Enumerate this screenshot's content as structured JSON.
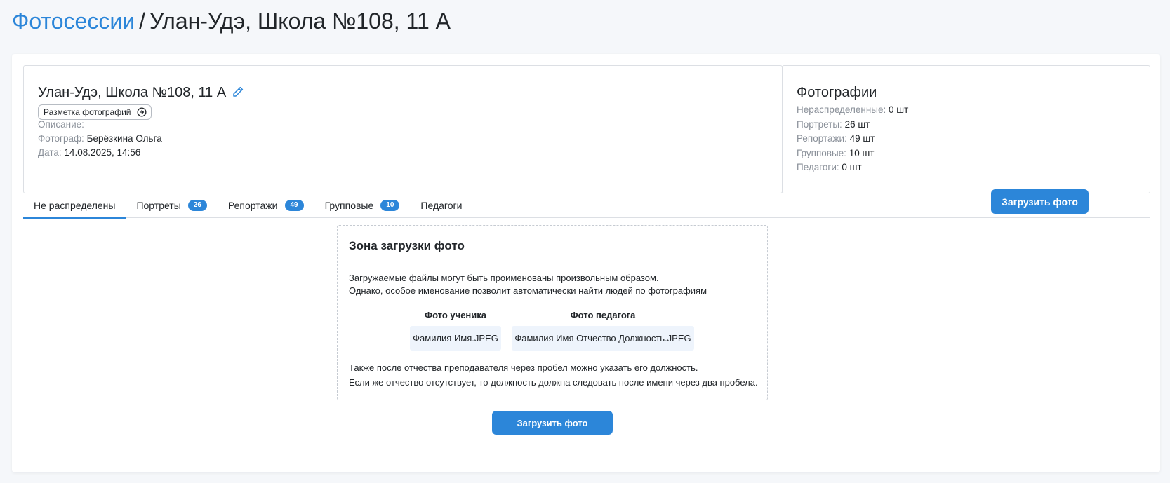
{
  "breadcrumb": {
    "root": "Фотосессии",
    "separator": "/",
    "current": "Улан-Удэ, Школа №108, 11 А"
  },
  "session": {
    "title": "Улан-Удэ, Школа №108, 11 А",
    "markup_button": "Разметка фотографий",
    "description_label": "Описание:",
    "description_value": "—",
    "photographer_label": "Фотограф:",
    "photographer_value": "Берёзкина Ольга",
    "date_label": "Дата:",
    "date_value": "14.08.2025, 14:56"
  },
  "stats": {
    "title": "Фотографии",
    "rows": [
      {
        "label": "Нераспределенные:",
        "value": "0 шт"
      },
      {
        "label": "Портреты:",
        "value": "26 шт"
      },
      {
        "label": "Репортажи:",
        "value": "49 шт"
      },
      {
        "label": "Групповые:",
        "value": "10 шт"
      },
      {
        "label": "Педагоги:",
        "value": "0 шт"
      }
    ]
  },
  "tabs": [
    {
      "label": "Не распределены",
      "badge": null,
      "active": true
    },
    {
      "label": "Портреты",
      "badge": "26",
      "active": false
    },
    {
      "label": "Репортажи",
      "badge": "49",
      "active": false
    },
    {
      "label": "Групповые",
      "badge": "10",
      "active": false
    },
    {
      "label": "Педагоги",
      "badge": null,
      "active": false
    }
  ],
  "upload_top_label": "Загрузить фото",
  "dropzone": {
    "title": "Зона загрузки фото",
    "line1": "Загружаемые файлы могут быть проименованы произвольным образом.",
    "line2": "Однако, особое именование позволит автоматически найти людей по фотографиям",
    "student_title": "Фото ученика",
    "student_example": "Фамилия Имя.JPEG",
    "teacher_title": "Фото педагога",
    "teacher_example": "Фамилия Имя Отчество Должность.JPEG",
    "note1": "Также после отчества преподавателя через пробел можно указать его должность.",
    "note2": "Если же отчество отсутствует, то должность должна следовать после имени через два пробела."
  },
  "upload_bottom_label": "Загрузить фото",
  "colors": {
    "accent": "#2c86d9",
    "background": "#f5f7fa",
    "muted_text": "#8a9099",
    "chip_bg": "#eef4fc"
  }
}
